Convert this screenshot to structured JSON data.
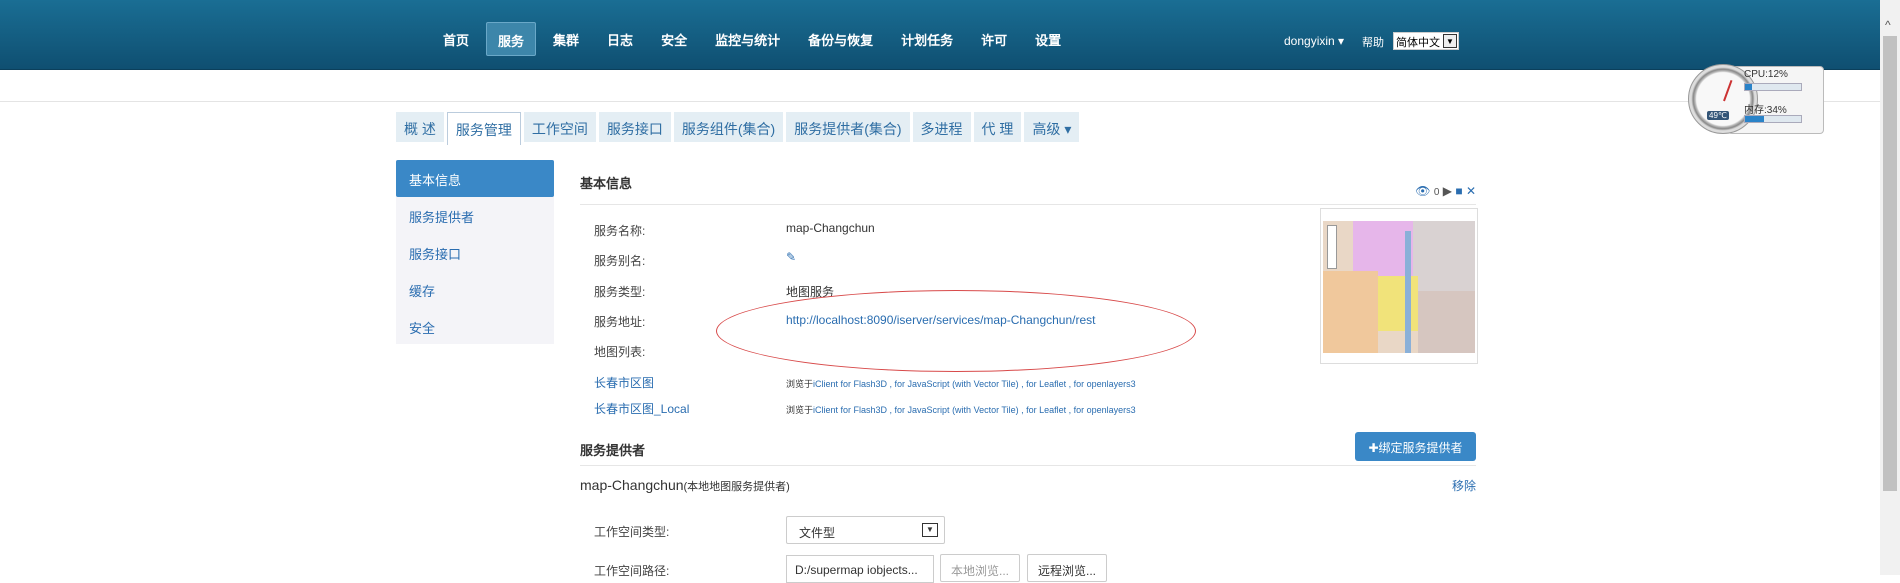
{
  "nav": {
    "items": [
      {
        "label": "首页"
      },
      {
        "label": "服务",
        "active": true
      },
      {
        "label": "集群"
      },
      {
        "label": "日志"
      },
      {
        "label": "安全"
      },
      {
        "label": "监控与统计"
      },
      {
        "label": "备份与恢复"
      },
      {
        "label": "计划任务"
      },
      {
        "label": "许可"
      },
      {
        "label": "设置"
      }
    ],
    "user": "dongyixin ▾",
    "help": "帮助",
    "language": "简体中文"
  },
  "monitor": {
    "cpu_label": "CPU:12%",
    "cpu_percent": 12,
    "mem_label": "内存:34%",
    "mem_percent": 34,
    "temperature": "49℃"
  },
  "tabs": [
    {
      "label": "概 述"
    },
    {
      "label": "服务管理",
      "active": true
    },
    {
      "label": "工作空间"
    },
    {
      "label": "服务接口"
    },
    {
      "label": "服务组件(集合)"
    },
    {
      "label": "服务提供者(集合)"
    },
    {
      "label": "多进程"
    },
    {
      "label": "代 理"
    },
    {
      "label": "高级 ▾"
    }
  ],
  "sidebar": {
    "items": [
      {
        "label": "基本信息",
        "active": true
      },
      {
        "label": "服务提供者"
      },
      {
        "label": "服务接口"
      },
      {
        "label": "缓存"
      },
      {
        "label": "安全"
      }
    ]
  },
  "basic": {
    "title": "基本信息",
    "view_count": "0",
    "service_name_label": "服务名称:",
    "service_name": "map-Changchun",
    "alias_label": "服务别名:",
    "type_label": "服务类型:",
    "type": "地图服务",
    "address_label": "服务地址:",
    "address": "http://localhost:8090/iserver/services/map-Changchun/rest",
    "maps_label": "地图列表:",
    "maps": [
      {
        "name": "长春市区图",
        "browse_prefix": "浏览于",
        "browse_links": "iClient for Flash3D , for JavaScript (with Vector Tile) , for Leaflet , for openlayers3"
      },
      {
        "name": "长春市区图_Local",
        "browse_prefix": "浏览于",
        "browse_links": "iClient for Flash3D , for JavaScript (with Vector Tile) , for Leaflet , for openlayers3"
      }
    ]
  },
  "providers": {
    "title": "服务提供者",
    "bind_button": "✚绑定服务提供者",
    "provider_name": "map-Changchun",
    "provider_type": "(本地地图服务提供者)",
    "remove": "移除",
    "workspace_type_label": "工作空间类型:",
    "workspace_type": "文件型",
    "workspace_path_label": "工作空间路径:",
    "workspace_path": "D:/supermap iobjects...",
    "local_browse": "本地浏览...",
    "remote_browse": "远程浏览..."
  },
  "colors": {
    "topbar": "#0f4f71",
    "accent": "#3a88c7",
    "link": "#2a6db0",
    "highlight_ellipse": "#d84a4a"
  }
}
